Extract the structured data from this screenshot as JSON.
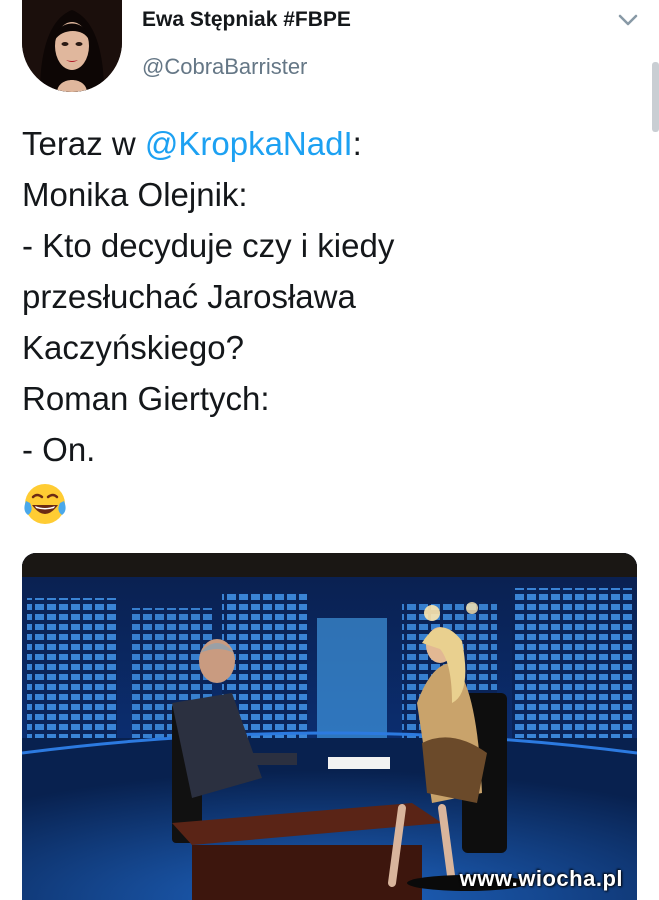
{
  "author": {
    "name": "Ewa Stępniak  #FBPE",
    "handle": "@CobraBarrister"
  },
  "tweet": {
    "lines": [
      {
        "before": "Teraz w ",
        "mention": "@KropkaNadI",
        "after": ":"
      },
      {
        "text": "Monika Olejnik:"
      },
      {
        "text": "- Kto decyduje czy i kiedy"
      },
      {
        "text": "przesłuchać Jarosława"
      },
      {
        "text": "Kaczyńskiego?"
      },
      {
        "text": "Roman Giertych:"
      },
      {
        "text": "- On."
      }
    ],
    "emoji": "face-with-tears-of-joy"
  },
  "media": {
    "watermark": "www.wiocha.pl"
  },
  "icons": {
    "chevron": "chevron-down-icon"
  },
  "colors": {
    "link": "#1da1f2",
    "text": "#14171a",
    "secondary": "#657786"
  }
}
